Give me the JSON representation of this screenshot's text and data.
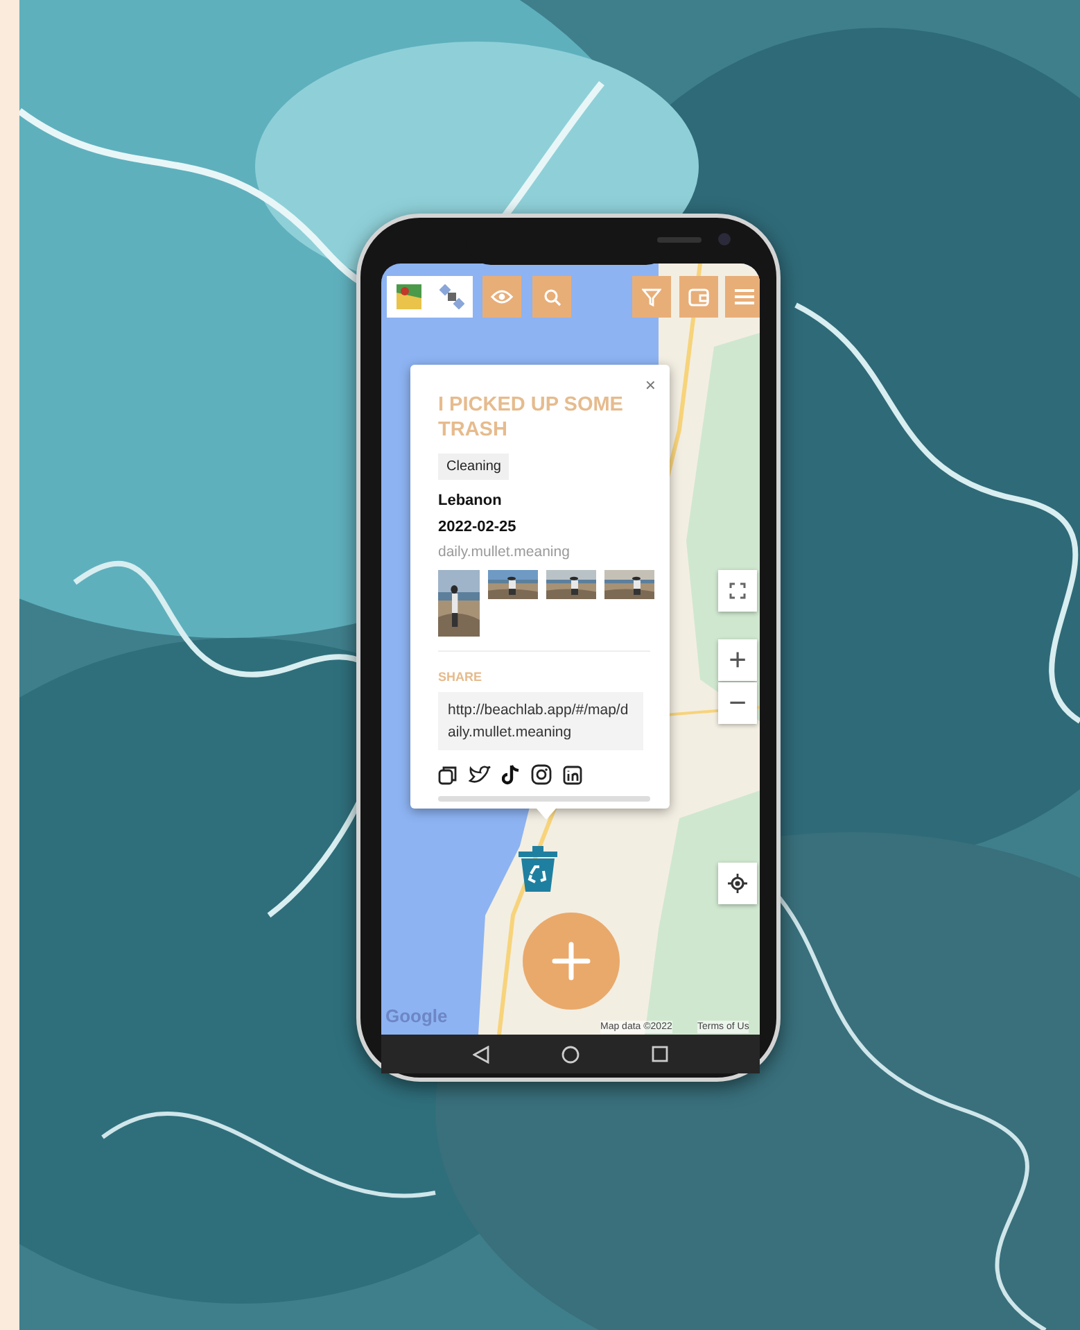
{
  "popup": {
    "close": "×",
    "title": "I PICKED UP SOME TRASH",
    "tag": "Cleaning",
    "location": "Lebanon",
    "date": "2022-02-25",
    "user": "daily.mullet.meaning",
    "share": {
      "heading": "SHARE",
      "url": "http://beachlab.app/#/map/daily.mullet.meaning"
    }
  },
  "map_controls": {
    "zoom_in": "+",
    "zoom_out": "−"
  },
  "attribution": {
    "logo": "Google",
    "data": "Map data ©2022",
    "terms": "Terms of Us"
  }
}
